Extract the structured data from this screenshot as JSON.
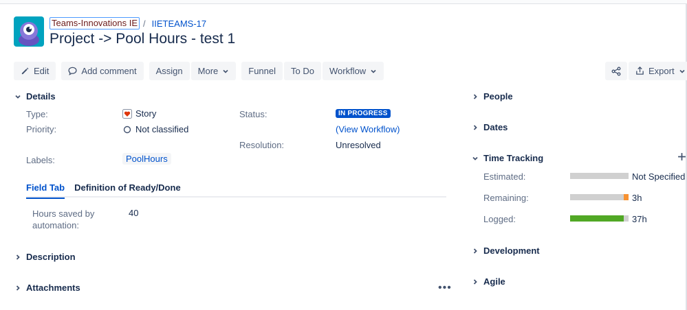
{
  "breadcrumb": {
    "project": "Teams-Innovations IE",
    "separator": "/",
    "issue_key": "IIETEAMS-17"
  },
  "issue_title": "Project -> Pool Hours - test 1",
  "toolbar": {
    "edit": "Edit",
    "add_comment": "Add comment",
    "assign": "Assign",
    "more": "More",
    "funnel": "Funnel",
    "todo": "To Do",
    "workflow": "Workflow",
    "export": "Export"
  },
  "details": {
    "heading": "Details",
    "type_label": "Type:",
    "type_value": "Story",
    "priority_label": "Priority:",
    "priority_value": "Not classified",
    "status_label": "Status:",
    "status_value": "IN PROGRESS",
    "view_workflow": "(View Workflow)",
    "resolution_label": "Resolution:",
    "resolution_value": "Unresolved",
    "labels_label": "Labels:",
    "labels_value": "PoolHours"
  },
  "tabs": [
    "Field Tab",
    "Definition of Ready/Done"
  ],
  "field_tab": {
    "label_line1": "Hours saved by",
    "label_line2": "automation:",
    "value": "40"
  },
  "sections": {
    "description": "Description",
    "attachments": "Attachments"
  },
  "right_panel": {
    "people": "People",
    "dates": "Dates",
    "time_tracking": "Time Tracking",
    "estimated_label": "Estimated:",
    "estimated_value": "Not Specified",
    "remaining_label": "Remaining:",
    "remaining_value": "3h",
    "logged_label": "Logged:",
    "logged_value": "37h",
    "development": "Development",
    "agile": "Agile"
  },
  "colors": {
    "logged_bar": "#51a825",
    "remaining_bar": "#f79232",
    "status_badge": "#0052cc"
  }
}
